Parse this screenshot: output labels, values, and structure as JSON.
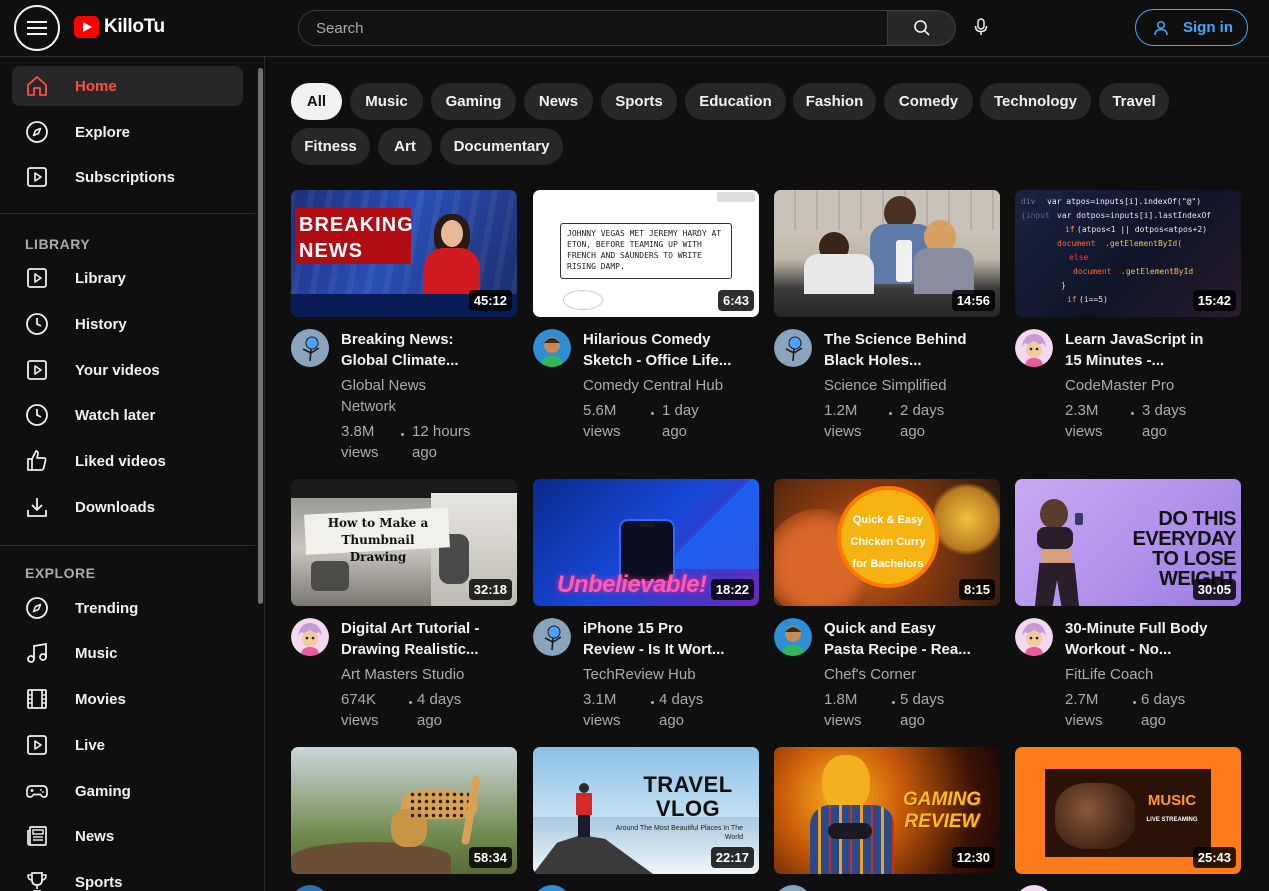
{
  "header": {
    "logo_text": "KilloTu",
    "search_placeholder": "Search",
    "signin_label": "Sign in"
  },
  "sidebar": {
    "main": [
      {
        "label": "Home",
        "icon": "home-icon"
      },
      {
        "label": "Explore",
        "icon": "compass-icon"
      },
      {
        "label": "Subscriptions",
        "icon": "subscriptions-icon"
      }
    ],
    "library_title": "LIBRARY",
    "library": [
      {
        "label": "Library",
        "icon": "library-icon"
      },
      {
        "label": "History",
        "icon": "history-icon"
      },
      {
        "label": "Your videos",
        "icon": "your-videos-icon"
      },
      {
        "label": "Watch later",
        "icon": "clock-icon"
      },
      {
        "label": "Liked videos",
        "icon": "thumbs-up-icon"
      },
      {
        "label": "Downloads",
        "icon": "download-icon"
      }
    ],
    "explore_title": "EXPLORE",
    "explore": [
      {
        "label": "Trending",
        "icon": "compass-icon"
      },
      {
        "label": "Music",
        "icon": "music-note-icon"
      },
      {
        "label": "Movies",
        "icon": "film-icon"
      },
      {
        "label": "Live",
        "icon": "live-icon"
      },
      {
        "label": "Gaming",
        "icon": "gamepad-icon"
      },
      {
        "label": "News",
        "icon": "newspaper-icon"
      },
      {
        "label": "Sports",
        "icon": "trophy-icon"
      }
    ]
  },
  "chips": [
    "All",
    "Music",
    "Gaming",
    "News",
    "Sports",
    "Education",
    "Fashion",
    "Comedy",
    "Technology",
    "Travel",
    "Fitness",
    "Art",
    "Documentary"
  ],
  "videos": [
    {
      "title_1": "Breaking News:",
      "title_2": "Global Climate...",
      "channel": "Global News Network",
      "views": "3.8M views",
      "age": "12 hours ago",
      "duration": "45:12",
      "thumb_text": "BREAKING NEWS"
    },
    {
      "title_1": "Hilarious Comedy",
      "title_2": "Sketch - Office Life...",
      "channel": "Comedy Central Hub",
      "views": "5.6M views",
      "age": "1 day ago",
      "duration": "6:43",
      "thumb_text": "JOHNNY VEGAS MET JEREMY HARDY AT ETON, BEFORE TEAMING UP WITH FRENCH AND SAUNDERS TO WRITE RISING DAMP."
    },
    {
      "title_1": "The Science Behind",
      "title_2": "Black Holes...",
      "channel": "Science Simplified",
      "views": "1.2M views",
      "age": "2 days ago",
      "duration": "14:56"
    },
    {
      "title_1": "Learn JavaScript in",
      "title_2": "15 Minutes -...",
      "channel": "CodeMaster Pro",
      "views": "2.3M views",
      "age": "3 days ago",
      "duration": "15:42"
    },
    {
      "title_1": "Digital Art Tutorial -",
      "title_2": "Drawing Realistic...",
      "channel": "Art Masters Studio",
      "views": "674K views",
      "age": "4 days ago",
      "duration": "32:18",
      "thumb_text": "How to Make a Thumbnail Drawing"
    },
    {
      "title_1": "iPhone 15 Pro",
      "title_2": "Review - Is It Wort...",
      "channel": "TechReview Hub",
      "views": "3.1M views",
      "age": "4 days ago",
      "duration": "18:22",
      "thumb_text": "Unbelievable!"
    },
    {
      "title_1": "Quick and Easy",
      "title_2": "Pasta Recipe - Rea...",
      "channel": "Chef's Corner",
      "views": "1.8M views",
      "age": "5 days ago",
      "duration": "8:15",
      "thumb_text": "Quick & Easy Chicken Curry for Bachelors"
    },
    {
      "title_1": "30-Minute Full Body",
      "title_2": "Workout - No...",
      "channel": "FitLife Coach",
      "views": "2.7M views",
      "age": "6 days ago",
      "duration": "30:05",
      "thumb_text": "DO THIS EVERYDAY TO LOSE WEIGHT"
    },
    {
      "duration": "58:34"
    },
    {
      "duration": "22:17",
      "thumb_text": "TRAVEL VLOG",
      "thumb_sub": "Around The Most Beautiful Places In The World"
    },
    {
      "duration": "12:30",
      "thumb_text": "GAMING REVIEW"
    },
    {
      "duration": "25:43",
      "thumb_text": "MUSIC",
      "thumb_sub": "LIVE STREAMING"
    }
  ]
}
